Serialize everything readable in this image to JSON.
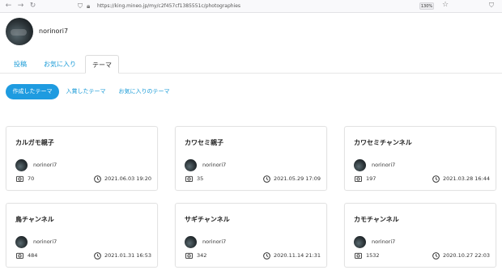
{
  "browser": {
    "back_icon": "arrow-left-icon",
    "forward_icon": "arrow-right-icon",
    "reload_icon": "reload-icon",
    "url": "https://king.mineo.jp/my/c2f457cf1385551c/photographies",
    "zoom": "130%"
  },
  "profile": {
    "username": "norinori7"
  },
  "tabs": [
    {
      "label": "投稿"
    },
    {
      "label": "お気に入り"
    },
    {
      "label": "テーマ"
    }
  ],
  "subtabs": [
    {
      "label": "作成したテーマ"
    },
    {
      "label": "入賞したテーマ"
    },
    {
      "label": "お気に入りのテーマ"
    }
  ],
  "colors": {
    "accent": "#1e9be0",
    "link": "#1a9bd7"
  },
  "cards": [
    {
      "title": "カルガモ親子",
      "user": "norinori7",
      "count": "70",
      "date": "2021.06.03 19:20"
    },
    {
      "title": "カワセミ親子",
      "user": "norinori7",
      "count": "35",
      "date": "2021.05.29 17:09"
    },
    {
      "title": "カワセミチャンネル",
      "user": "norinori7",
      "count": "197",
      "date": "2021.03.28 16:44"
    },
    {
      "title": "鳥チャンネル",
      "user": "norinori7",
      "count": "484",
      "date": "2021.01.31 16:53"
    },
    {
      "title": "サギチャンネル",
      "user": "norinori7",
      "count": "342",
      "date": "2020.11.14 21:31"
    },
    {
      "title": "カモチャンネル",
      "user": "norinori7",
      "count": "1532",
      "date": "2020.10.27 22:03"
    }
  ]
}
